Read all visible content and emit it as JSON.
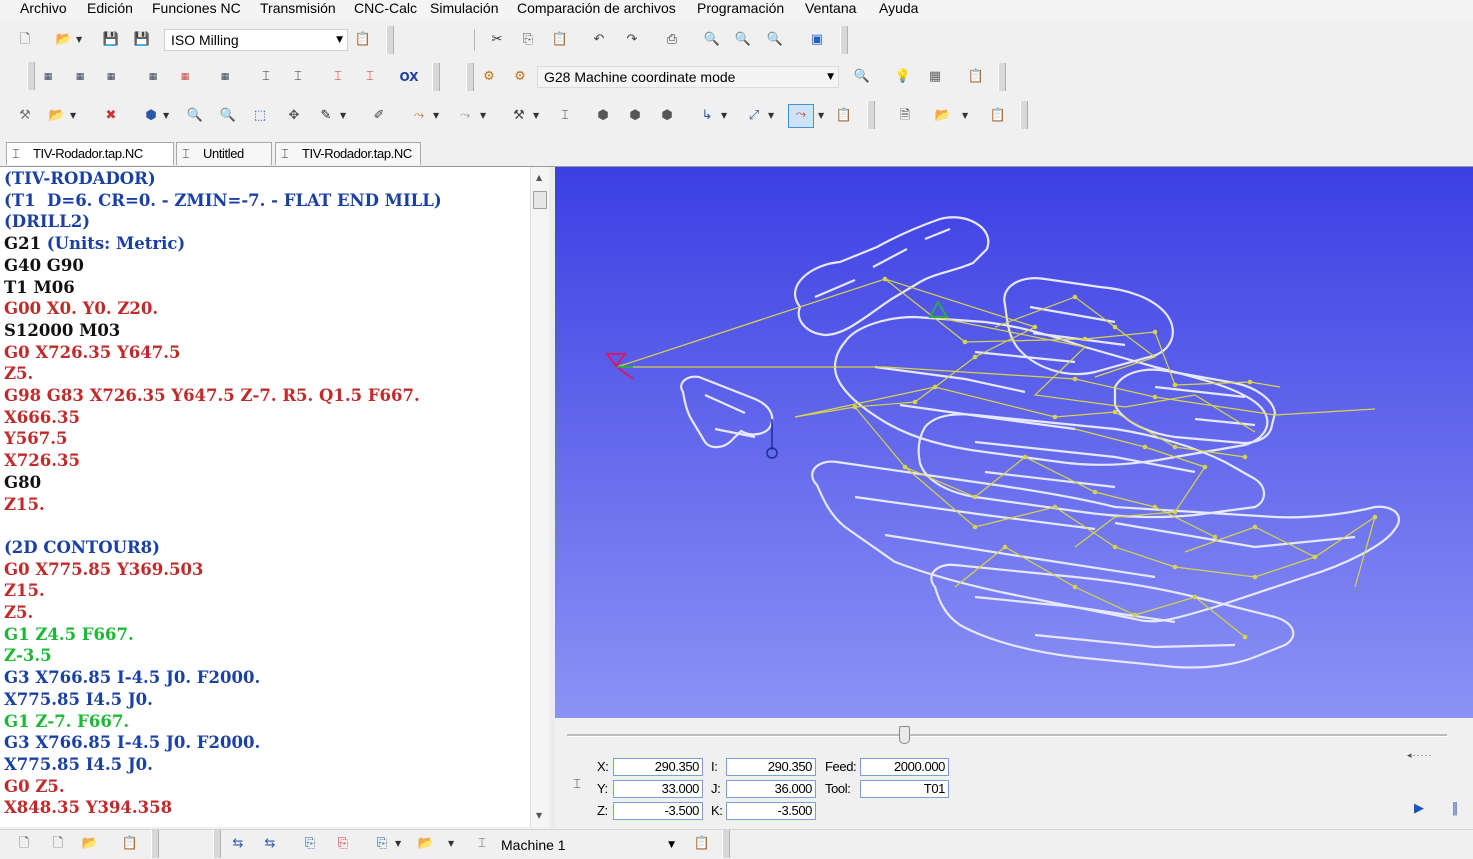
{
  "menu": {
    "archivo": "Archivo",
    "edicion": "Edición",
    "funciones_nc": "Funciones NC",
    "transmision": "Transmisión",
    "cnc_calc": "CNC-Calc",
    "simulacion": "Simulación",
    "comparacion": "Comparación de archivos",
    "programacion": "Programación",
    "ventana": "Ventana",
    "ayuda": "Ayuda"
  },
  "toolbar": {
    "machine_type": "ISO Milling",
    "coordinate_mode": "G28 Machine coordinate mode",
    "ox_label": "OX"
  },
  "tabs": [
    {
      "label": "TIV-Rodador.tap.NC"
    },
    {
      "label": "Untitled"
    },
    {
      "label": "TIV-Rodador.tap.NC"
    }
  ],
  "code_lines": [
    {
      "text": "(TIV-RODADOR)",
      "color": "blue"
    },
    {
      "text": "(T1  D=6. CR=0. - ZMIN=-7. - FLAT END MILL)",
      "color": "blue"
    },
    {
      "text": "(DRILL2)",
      "color": "blue"
    },
    {
      "text": "G21 (Units: Metric)",
      "color": "mixed_g21"
    },
    {
      "text": "G40 G90",
      "color": "black"
    },
    {
      "text": "T1 M06",
      "color": "black"
    },
    {
      "text": "G00 X0. Y0. Z20.",
      "color": "red"
    },
    {
      "text": "S12000 M03",
      "color": "black"
    },
    {
      "text": "G0 X726.35 Y647.5",
      "color": "red"
    },
    {
      "text": "Z5.",
      "color": "red"
    },
    {
      "text": "G98 G83 X726.35 Y647.5 Z-7. R5. Q1.5 F667.",
      "color": "red"
    },
    {
      "text": "X666.35",
      "color": "red"
    },
    {
      "text": "Y567.5",
      "color": "red"
    },
    {
      "text": "X726.35",
      "color": "red"
    },
    {
      "text": "G80",
      "color": "black"
    },
    {
      "text": "Z15.",
      "color": "red"
    },
    {
      "text": "",
      "color": "black"
    },
    {
      "text": "(2D CONTOUR8)",
      "color": "blue"
    },
    {
      "text": "G0 X775.85 Y369.503",
      "color": "red"
    },
    {
      "text": "Z15.",
      "color": "red"
    },
    {
      "text": "Z5.",
      "color": "red"
    },
    {
      "text": "G1 Z4.5 F667.",
      "color": "green"
    },
    {
      "text": "Z-3.5",
      "color": "green"
    },
    {
      "text": "G3 X766.85 I-4.5 J0. F2000.",
      "color": "blue"
    },
    {
      "text": "X775.85 I4.5 J0.",
      "color": "blue"
    },
    {
      "text": "G1 Z-7. F667.",
      "color": "green"
    },
    {
      "text": "G3 X766.85 I-4.5 J0. F2000.",
      "color": "blue"
    },
    {
      "text": "X775.85 I4.5 J0.",
      "color": "blue"
    },
    {
      "text": "G0 Z5.",
      "color": "red"
    },
    {
      "text": "X848.35 Y394.358",
      "color": "red"
    }
  ],
  "readout": {
    "x_label": "X:",
    "y_label": "Y:",
    "z_label": "Z:",
    "i_label": "I:",
    "j_label": "J:",
    "k_label": "K:",
    "feed_label": "Feed:",
    "tool_label": "Tool:",
    "x": "290.350",
    "y": "33.000",
    "z": "-3.500",
    "i": "290.350",
    "j": "36.000",
    "k": "-3.500",
    "feed": "2000.000",
    "tool": "T01"
  },
  "bottom": {
    "machine": "Machine 1"
  },
  "colors": {
    "view_top": "#3c3fe3",
    "view_bottom": "#8c93f5",
    "part_outline": "#e6e8ff",
    "toolpath": "#d8d44a",
    "code_blue": "#1a3fa5",
    "code_red": "#c22a2a",
    "code_green": "#1bb833"
  }
}
